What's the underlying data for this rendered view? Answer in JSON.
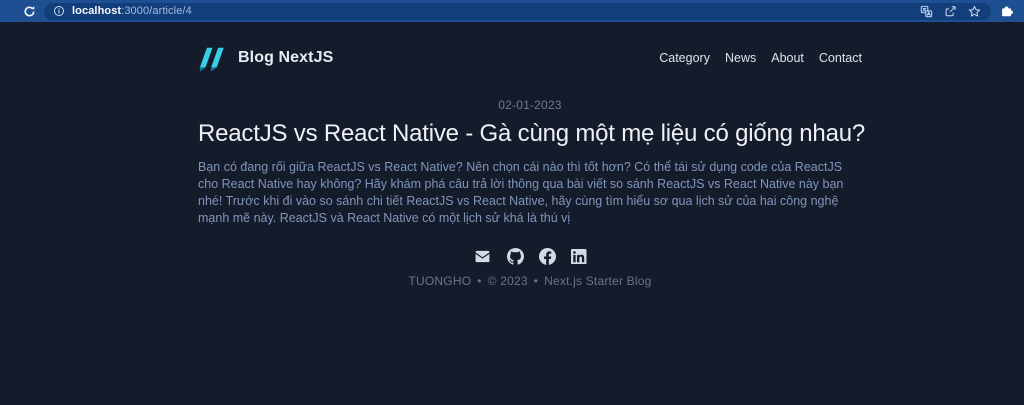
{
  "browser": {
    "url": {
      "host": "localhost",
      "path": ":3000/article/4"
    },
    "icons": {
      "reload": "reload-icon",
      "info": "info-icon",
      "translate": "translate-icon",
      "share": "share-icon",
      "favorites": "star-icon",
      "extensions": "puzzle-icon"
    }
  },
  "header": {
    "brand": "Blog NextJS",
    "nav": [
      {
        "label": "Category"
      },
      {
        "label": "News"
      },
      {
        "label": "About"
      },
      {
        "label": "Contact"
      }
    ]
  },
  "article": {
    "date": "02-01-2023",
    "title": "ReactJS vs React Native - Gà cùng một mẹ liệu có giống nhau?",
    "summary": "Bạn có đang rối giữa ReactJS vs React Native? Nên chọn cái nào thì tốt hơn? Có thể tái sử dụng code của ReactJS cho React Native hay không? Hãy khám phá câu trả lời thông qua bài viết so sánh ReactJS vs React Native này bạn nhé! Trước khi đi vào so sánh chi tiết ReactJS vs React Native, hãy cùng tìm hiểu sơ qua lịch sử của hai công nghệ mạnh mẽ này. ReactJS và React Native có một lịch sử khá là thú vị"
  },
  "footer": {
    "author": "TUONGHO",
    "copyright": "© 2023",
    "site_name": "Next.js Starter Blog",
    "separator": "•",
    "social_icons": [
      "mail-icon",
      "github-icon",
      "facebook-icon",
      "linkedin-icon"
    ]
  },
  "colors": {
    "browser_bar": "#1e4f93",
    "address_pill": "#123f7c",
    "page_background": "#141c2b",
    "brand_accent": "#36cfe3",
    "brand_accent_dark": "#0b7f97",
    "title_text": "#eef1f6",
    "summary_text": "#8095ba",
    "muted_text": "#6a7489"
  }
}
